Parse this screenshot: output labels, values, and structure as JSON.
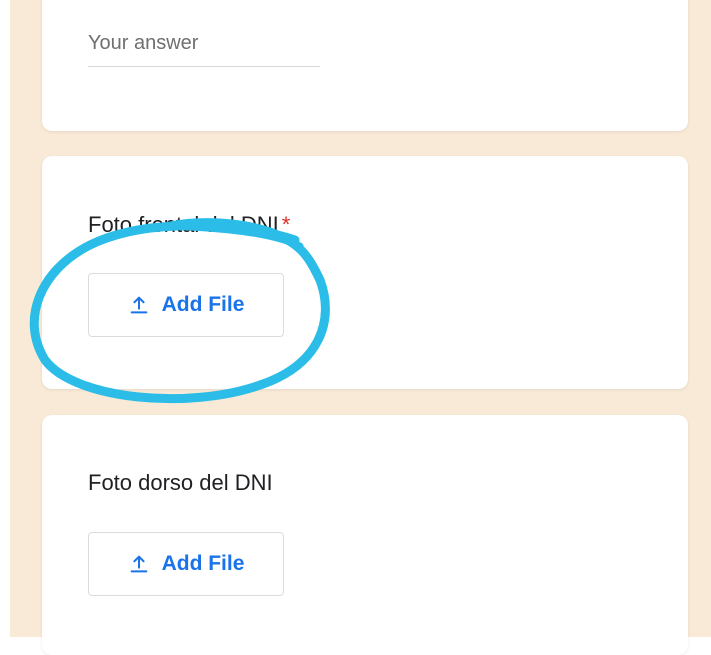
{
  "form": {
    "answer_placeholder": "Your answer",
    "questions": [
      {
        "title": "Foto frontal del DNI",
        "required_mark": "*",
        "add_file_label": "Add File"
      },
      {
        "title": "Foto dorso del DNI",
        "add_file_label": "Add File"
      }
    ]
  },
  "icons": {
    "upload": "upload-icon"
  },
  "colors": {
    "background": "#f8ead6",
    "accent": "#1a73e8",
    "required": "#d93025",
    "annotation": "#2bbde7"
  }
}
